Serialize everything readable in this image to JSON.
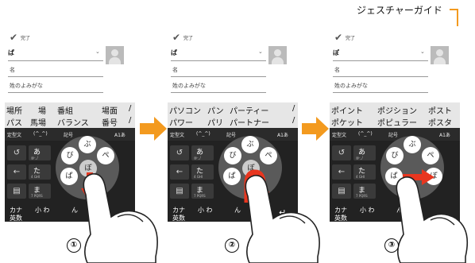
{
  "callout": "ジェスチャーガイド",
  "callout_num": [
    "①",
    "②",
    "③"
  ],
  "colors": {
    "accent": "#f39a1f",
    "gesture_arrow": "#e8361f",
    "keyboard_bg": "#222222",
    "candidate_bg": "#e6e6e6"
  },
  "screens": [
    {
      "done_label": "完了",
      "name_kanji": "ぱ",
      "field_name": "名",
      "field_reading": "姓のよみがな",
      "candidates_row1": [
        "場所",
        "場",
        "番組",
        "場面",
        "/"
      ],
      "candidates_row2": [
        "パス",
        "馬場",
        "バランス",
        "番号",
        "/"
      ],
      "mode": [
        "定型文",
        "(^_^)",
        "記号",
        "A1あ"
      ],
      "key_a": "あ",
      "key_ta": "た",
      "key_ma": "ま",
      "sub_a": "@-_/",
      "sub_ta": "4 GHI",
      "sub_ma": "7 PQRS",
      "bottom": [
        "カナ",
        "英数",
        "小 わ",
        "ん"
      ],
      "petals": [
        "ぶ",
        "び",
        "ぱ",
        "ぺ",
        "ぽ",
        "ぴ"
      ]
    },
    {
      "done_label": "完了",
      "name_kanji": "ぱ",
      "field_name": "名",
      "field_reading": "姓のよみがな",
      "candidates_row1": [
        "パソコン",
        "パン",
        "パーティー",
        "/"
      ],
      "candidates_row2": [
        "パワー",
        "パリ",
        "パートナー",
        "/"
      ],
      "mode": [
        "定型文",
        "(^_^)",
        "記号",
        "A1あ"
      ],
      "key_a": "あ",
      "key_ta": "た",
      "key_ma": "ま",
      "sub_a": "@-_/",
      "sub_ta": "4 GHI",
      "sub_ma": "7 PQRS",
      "bottom": [
        "カナ",
        "英数",
        "小 わ",
        "ん"
      ],
      "petals": [
        "ぶ",
        "び",
        "ぱ",
        "ぺ",
        "ぽ",
        "ぴ"
      ]
    },
    {
      "done_label": "完了",
      "name_kanji": "ぽ",
      "field_name": "名",
      "field_reading": "姓のよみがな",
      "candidates_row1": [
        "ポイント",
        "ポジション",
        "ポスト"
      ],
      "candidates_row2": [
        "ポケット",
        "ポピュラー",
        "ポスタ"
      ],
      "mode": [
        "定型文",
        "(^_^)",
        "記号",
        "A1あ"
      ],
      "key_a": "あ",
      "key_ta": "た",
      "key_ma": "ま",
      "sub_a": "@-_/",
      "sub_ta": "4 GHI",
      "sub_ma": "7 PQRS",
      "bottom": [
        "カナ",
        "英数",
        "小 わ",
        "ん"
      ],
      "petals": [
        "ぶ",
        "び",
        "ぱ",
        "ぺ",
        "ぽ",
        "ぴ"
      ]
    }
  ]
}
